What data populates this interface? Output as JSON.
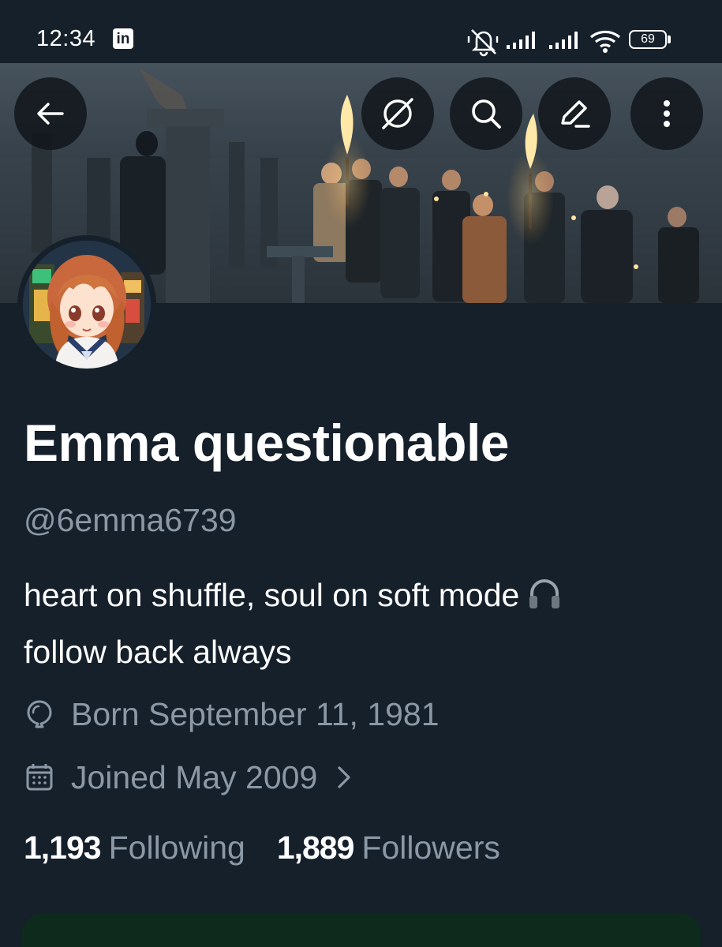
{
  "status_bar": {
    "time": "12:34",
    "app_badge": "in",
    "battery": "69",
    "icons": [
      "muted-bell-icon",
      "signal-bars-icon",
      "signal-bars-icon",
      "wifi-icon",
      "battery-icon"
    ]
  },
  "header": {
    "buttons": [
      "back-arrow-icon",
      "grok-icon",
      "search-icon",
      "edit-pencil-icon",
      "more-vertical-icon"
    ]
  },
  "profile": {
    "display_name": "Emma questionable",
    "handle": "@6emma6739",
    "bio_line1": "heart on shuffle, soul on soft mode",
    "bio_line2": "follow back always",
    "bio_emoji": "headphone-icon",
    "birthday": "Born September 11, 1981",
    "joined": "Joined May 2009",
    "following_count": "1,193",
    "following_label": "Following",
    "followers_count": "1,889",
    "followers_label": "Followers"
  },
  "colors": {
    "background": "#15202b",
    "secondary_text": "#8b98a5",
    "primary_text": "#ffffff",
    "header_button_bg": "#0f1419"
  }
}
